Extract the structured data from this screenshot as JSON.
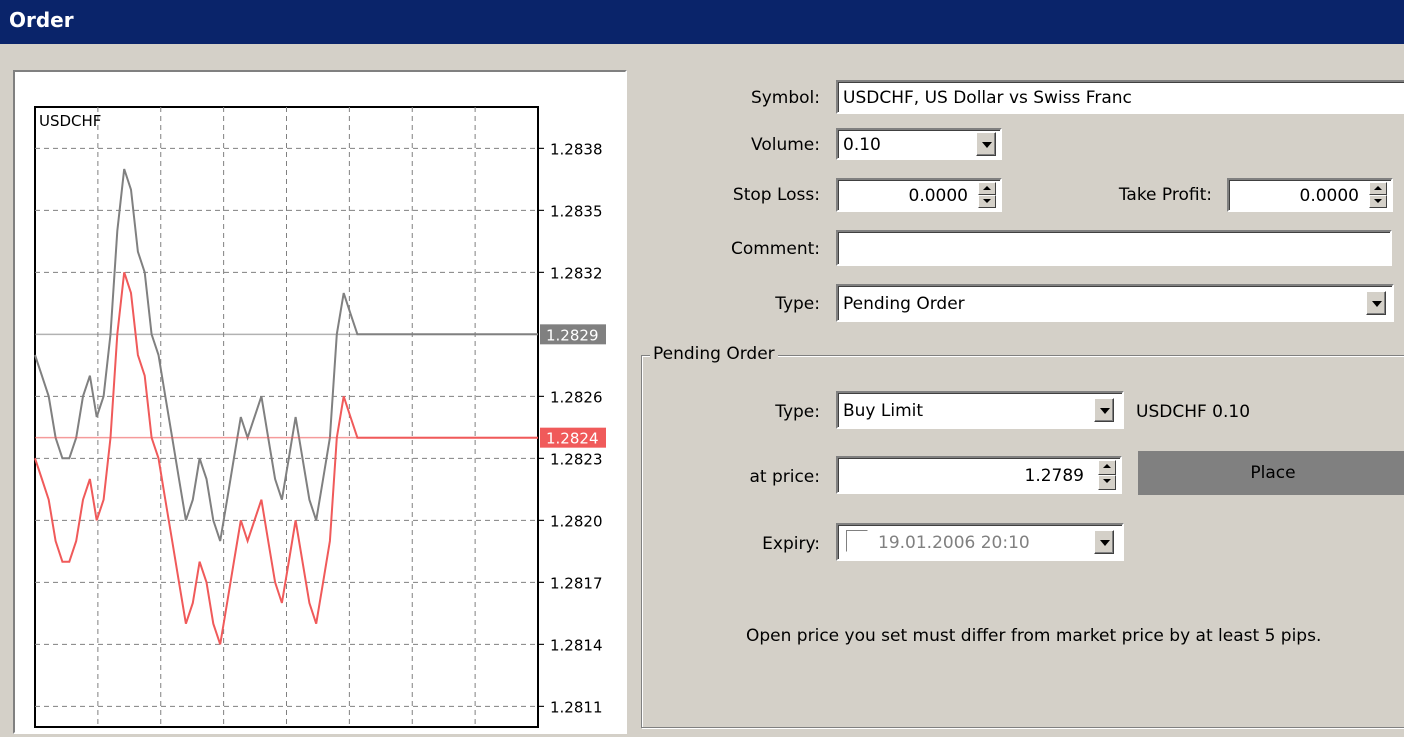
{
  "window": {
    "title": "Order"
  },
  "chart_data": {
    "type": "line",
    "symbol_label": "USDCHF",
    "y_ticks": [
      "1.2838",
      "1.2835",
      "1.2832",
      "1.2826",
      "1.2823",
      "1.2820",
      "1.2817",
      "1.2814",
      "1.2811"
    ],
    "ylim": [
      1.281,
      1.284
    ],
    "grid": true,
    "series": [
      {
        "color": "#808080",
        "current": 1.2829,
        "current_label": "1.2829",
        "values": [
          1.2828,
          1.2827,
          1.2826,
          1.2824,
          1.2823,
          1.2823,
          1.2824,
          1.2826,
          1.2827,
          1.2825,
          1.2826,
          1.2829,
          1.2834,
          1.2837,
          1.2836,
          1.2833,
          1.2832,
          1.2829,
          1.2828,
          1.2826,
          1.2824,
          1.2822,
          1.282,
          1.2821,
          1.2823,
          1.2822,
          1.282,
          1.2819,
          1.2821,
          1.2823,
          1.2825,
          1.2824,
          1.2825,
          1.2826,
          1.2824,
          1.2822,
          1.2821,
          1.2823,
          1.2825,
          1.2823,
          1.2821,
          1.282,
          1.2822,
          1.2824,
          1.2829,
          1.2831,
          1.283,
          1.2829,
          1.2829,
          1.2829,
          1.2829,
          1.2829,
          1.2829,
          1.2829,
          1.2829,
          1.2829,
          1.2829,
          1.2829,
          1.2829,
          1.2829
        ]
      },
      {
        "color": "#f05a5a",
        "current": 1.2824,
        "current_label": "1.2824",
        "values": [
          1.2823,
          1.2822,
          1.2821,
          1.2819,
          1.2818,
          1.2818,
          1.2819,
          1.2821,
          1.2822,
          1.282,
          1.2821,
          1.2824,
          1.2829,
          1.2832,
          1.2831,
          1.2828,
          1.2827,
          1.2824,
          1.2823,
          1.2821,
          1.2819,
          1.2817,
          1.2815,
          1.2816,
          1.2818,
          1.2817,
          1.2815,
          1.2814,
          1.2816,
          1.2818,
          1.282,
          1.2819,
          1.282,
          1.2821,
          1.2819,
          1.2817,
          1.2816,
          1.2818,
          1.282,
          1.2818,
          1.2816,
          1.2815,
          1.2817,
          1.2819,
          1.2824,
          1.2826,
          1.2825,
          1.2824,
          1.2824,
          1.2824,
          1.2824,
          1.2824,
          1.2824,
          1.2824,
          1.2824,
          1.2824,
          1.2824,
          1.2824,
          1.2824,
          1.2824
        ]
      }
    ]
  },
  "form": {
    "symbol_label": "Symbol:",
    "symbol_value": "USDCHF, US Dollar vs Swiss Franc",
    "volume_label": "Volume:",
    "volume_value": "0.10",
    "stop_loss_label": "Stop Loss:",
    "stop_loss_value": "0.0000",
    "take_profit_label": "Take Profit:",
    "take_profit_value": "0.0000",
    "comment_label": "Comment:",
    "comment_value": "",
    "type_label": "Type:",
    "type_value": "Pending Order"
  },
  "pending": {
    "group_title": "Pending Order",
    "type_label": "Type:",
    "type_value": "Buy Limit",
    "type_summary": "USDCHF 0.10",
    "price_label": "at price:",
    "price_value": "1.2789",
    "place_label": "Place",
    "expiry_label": "Expiry:",
    "expiry_value": "19.01.2006 20:10",
    "notice": "Open price you set must differ from market price by at least 5 pips."
  }
}
